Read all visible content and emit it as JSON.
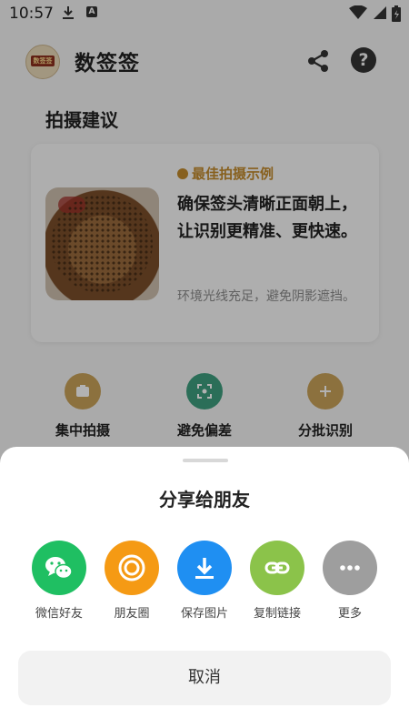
{
  "status_bar": {
    "time": "10:57",
    "a_badge": "A"
  },
  "app_bar": {
    "logo_text": "数签签",
    "title": "数签签",
    "help_glyph": "?"
  },
  "section": {
    "title": "拍摄建议"
  },
  "tip_card": {
    "badge": "最佳拍摄示例",
    "main_text": "确保签头清晰正面朝上，让识别更精准、更快速。",
    "sub_text": "环境光线充足，避免阴影遮挡。"
  },
  "features": [
    {
      "label": "集中拍摄",
      "icon": "camera-icon",
      "color": "#c9a25a"
    },
    {
      "label": "避免偏差",
      "icon": "focus-icon",
      "color": "#3e9e7e"
    },
    {
      "label": "分批识别",
      "icon": "plus-icon",
      "color": "#c9a25a"
    }
  ],
  "share_sheet": {
    "title": "分享给朋友",
    "options": [
      {
        "label": "微信好友",
        "icon": "wechat-icon",
        "color": "#1fbf62"
      },
      {
        "label": "朋友圈",
        "icon": "moments-icon",
        "color": "#f59a14"
      },
      {
        "label": "保存图片",
        "icon": "download-icon",
        "color": "#1f8ff2"
      },
      {
        "label": "复制链接",
        "icon": "link-icon",
        "color": "#8bc34a"
      },
      {
        "label": "更多",
        "icon": "more-icon",
        "color": "#9e9e9e"
      }
    ],
    "cancel_label": "取消"
  }
}
